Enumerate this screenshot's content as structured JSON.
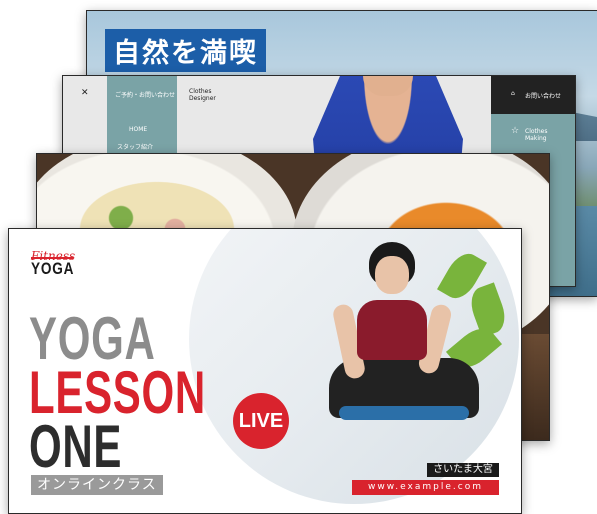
{
  "card_nature": {
    "title": "自然を満喫"
  },
  "card_designer": {
    "menu_items": [
      "ご予約・お問い合わせ",
      "HOME",
      "スタッフ紹介"
    ],
    "brand": "Clothes\nDesigner",
    "top_right_label": "お問い合わせ",
    "side_label": "Clothes Making"
  },
  "card_yoga": {
    "logo_script": "Fitness",
    "logo": "YOGA",
    "headline": [
      "YOGA",
      "LESSON",
      "ONE"
    ],
    "subtitle": "オンラインクラス",
    "badge": "LIVE",
    "location": "さいたま大宮",
    "url": "www.example.com",
    "colors": {
      "accent": "#d9232d",
      "gray": "#8c8c8c",
      "dark": "#2d2d2d"
    }
  }
}
